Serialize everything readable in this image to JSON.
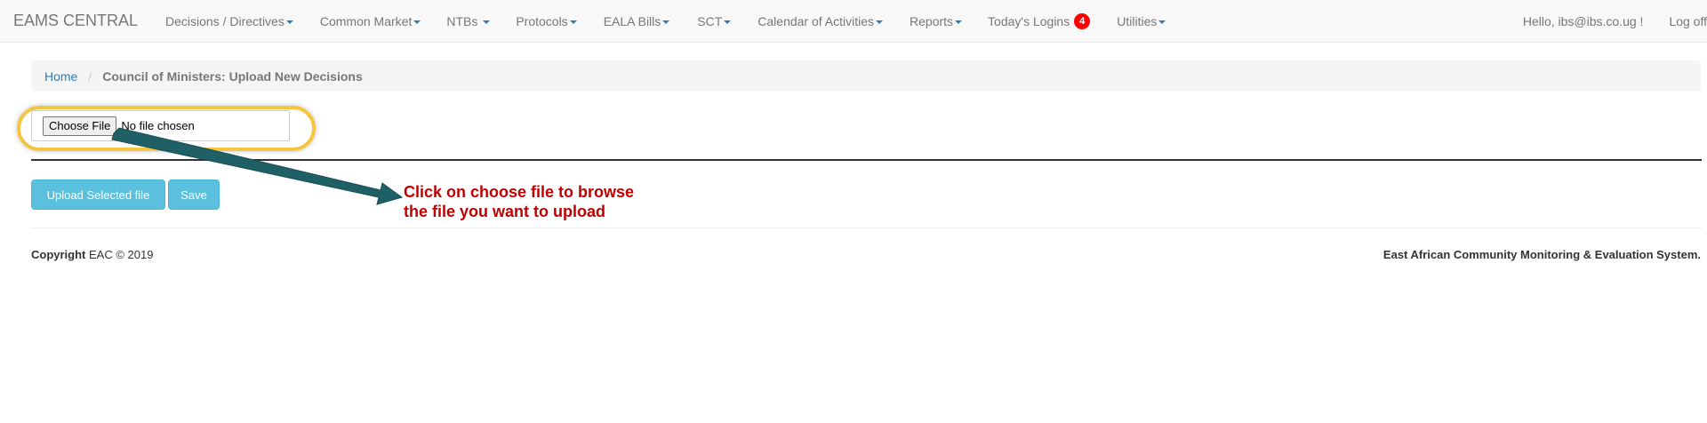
{
  "navbar": {
    "brand": "EAMS CENTRAL",
    "items": [
      {
        "label": "Decisions / Directives"
      },
      {
        "label": "Common Market"
      },
      {
        "label": "NTBs"
      },
      {
        "label": "Protocols"
      },
      {
        "label": "EALA Bills"
      },
      {
        "label": "SCT"
      },
      {
        "label": "Calendar of Activities"
      },
      {
        "label": "Reports"
      },
      {
        "label": "Today's Logins",
        "badge": "4"
      },
      {
        "label": "Utilities"
      }
    ],
    "greeting": "Hello, ibs@ibs.co.ug !",
    "logoff": "Log off"
  },
  "breadcrumb": {
    "home": "Home",
    "separator": "/",
    "current": "Council of Ministers: Upload New Decisions"
  },
  "file_input": {
    "button_label": "Choose File",
    "status": "No file chosen"
  },
  "actions": {
    "upload_label": "Upload Selected file",
    "save_label": "Save"
  },
  "annotation": {
    "line1": "Click on choose file to browse",
    "line2": "the file you want to upload",
    "color": "#c00000",
    "arrow_color": "#1f5f66",
    "highlight_color": "#f5c542"
  },
  "footer": {
    "copyright_label": "Copyright",
    "copyright_text": "EAC © 2019",
    "system_name": "East African Community Monitoring & Evaluation System."
  },
  "colors": {
    "link": "#337ab7",
    "button_info": "#5bc0de",
    "badge": "#ff0000",
    "navbar_bg": "#f8f8f8"
  }
}
